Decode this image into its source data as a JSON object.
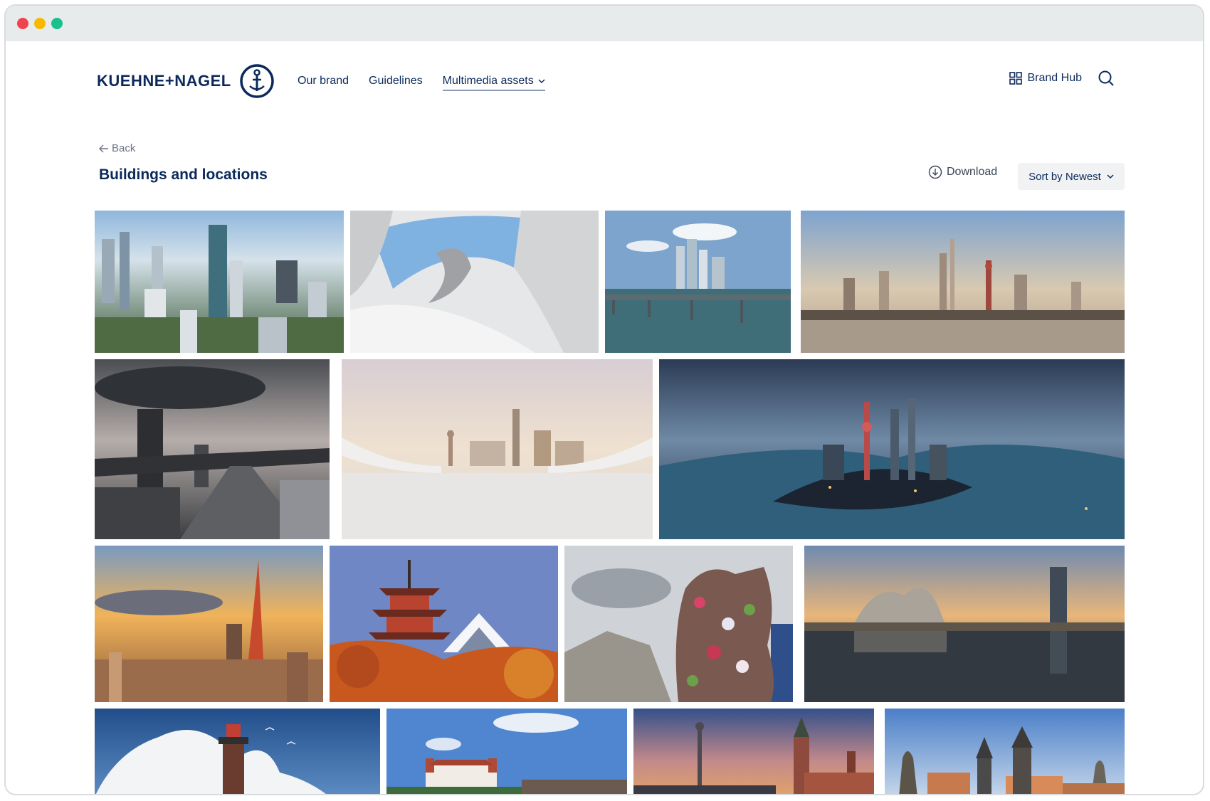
{
  "brand": {
    "name": "KUEHNE+NAGEL"
  },
  "nav": {
    "items": [
      {
        "label": "Our brand"
      },
      {
        "label": "Guidelines"
      },
      {
        "label": "Multimedia assets"
      }
    ]
  },
  "header": {
    "brand_hub_label": "Brand Hub"
  },
  "toolbar": {
    "back_label": "Back",
    "title": "Buildings and locations",
    "download_label": "Download",
    "sort_label": "Sort by Newest"
  },
  "colors": {
    "brand_navy": "#0b2a5b",
    "chrome_gray": "#e8ebec",
    "traffic_red": "#f0434f",
    "traffic_yellow": "#f6b800",
    "traffic_green": "#19c08c"
  },
  "gallery": {
    "images": [
      {
        "subject": "aerial city skyline with greenery"
      },
      {
        "subject": "abstract white curved architecture"
      },
      {
        "subject": "coastal skyscrapers and bridge"
      },
      {
        "subject": "Shanghai skyline across river"
      },
      {
        "subject": "stormy highway overpass city"
      },
      {
        "subject": "skyline framed by white structure"
      },
      {
        "subject": "Shanghai panorama at dusk"
      },
      {
        "subject": "Tokyo Tower at sunset"
      },
      {
        "subject": "pagoda with Mount Fuji in autumn"
      },
      {
        "subject": "flower dog sculpture"
      },
      {
        "subject": "Guggenheim museum at sunset"
      },
      {
        "subject": "lighthouse with crashing wave"
      },
      {
        "subject": "Bratislava castle"
      },
      {
        "subject": "Warsaw castle square"
      },
      {
        "subject": "Prague towers and statues"
      }
    ]
  }
}
